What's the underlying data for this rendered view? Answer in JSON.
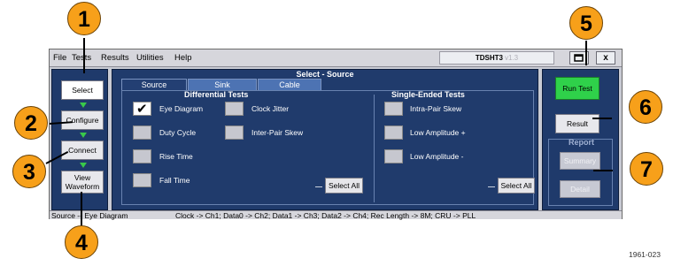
{
  "menu": {
    "items": [
      "File",
      "Tests",
      "Results",
      "Utilities",
      "Help"
    ]
  },
  "titlebar": {
    "app_name": "TDSHT3",
    "version": "v1.3",
    "window_icon": "window-restore-icon",
    "close_label": "x"
  },
  "left_panel": {
    "select_label": "Select",
    "configure_label": "Configure",
    "connect_label": "Connect",
    "view_waveform_label": "View Waveform"
  },
  "main_panel": {
    "title": "Select - Source",
    "tabs": [
      {
        "label": "Source",
        "active": true
      },
      {
        "label": "Sink",
        "active": false
      },
      {
        "label": "Cable",
        "active": false
      }
    ],
    "differential": {
      "title": "Differential Tests",
      "tests": [
        {
          "label": "Eye Diagram",
          "checked": true
        },
        {
          "label": "Duty Cycle",
          "checked": false
        },
        {
          "label": "Rise Time",
          "checked": false
        },
        {
          "label": "Fall Time",
          "checked": false
        },
        {
          "label": "Clock Jitter",
          "checked": false
        },
        {
          "label": "Inter-Pair Skew",
          "checked": false
        }
      ],
      "select_all_label": "Select All"
    },
    "single_ended": {
      "title": "Single-Ended Tests",
      "tests": [
        {
          "label": "Intra-Pair Skew",
          "checked": false
        },
        {
          "label": "Low Amplitude +",
          "checked": false
        },
        {
          "label": "Low Amplitude -",
          "checked": false
        }
      ],
      "select_all_label": "Select All"
    },
    "check_mark": "✔"
  },
  "right_panel": {
    "run_test_label": "Run Test",
    "result_label": "Result",
    "report_title": "Report",
    "summary_label": "Summary",
    "detail_label": "Detail"
  },
  "statusbar": {
    "left_text": "Source -- Eye Diagram",
    "right_text": "Clock -> Ch1; Data0 -> Ch2; Data1 -> Ch3; Data2 -> Ch4; Rec Length -> 8M; CRU -> PLL"
  },
  "callouts": [
    "1",
    "2",
    "3",
    "4",
    "5",
    "6",
    "7"
  ],
  "figure_id": "1961-023",
  "colors": {
    "panel_blue": "#1f3a6b",
    "run_green": "#2fd14a",
    "callout_orange": "#f7a01a",
    "step_arrow_green": "#39c94a"
  }
}
